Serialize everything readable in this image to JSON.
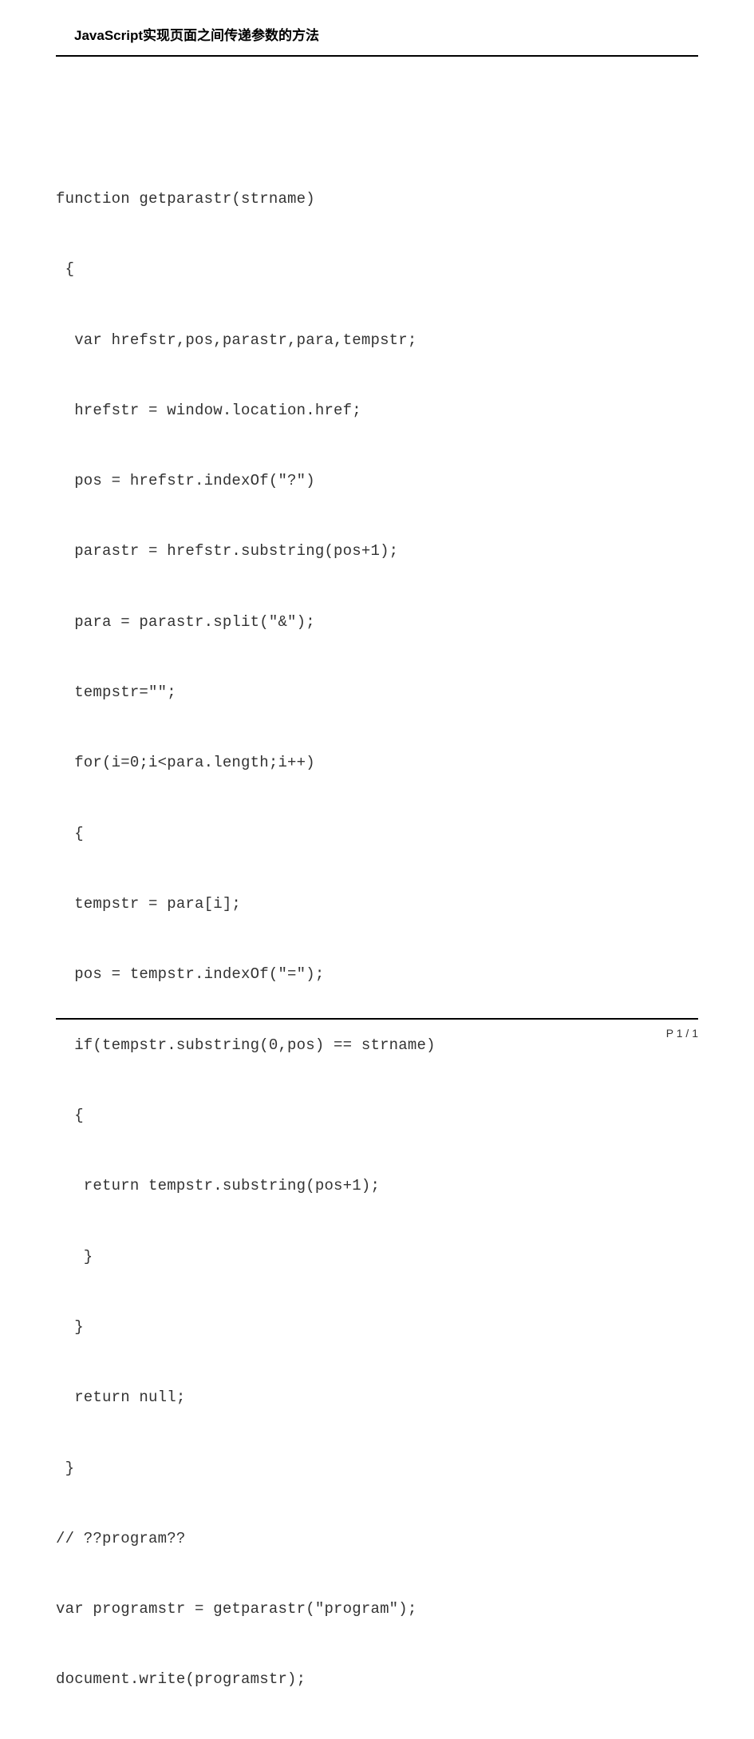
{
  "header": {
    "title": "JavaScript实现页面之间传递参数的方法"
  },
  "code": {
    "lines": [
      "function getparastr(strname)",
      " {",
      "  var hrefstr,pos,parastr,para,tempstr;",
      "  hrefstr = window.location.href;",
      "  pos = hrefstr.indexOf(\"?\")",
      "  parastr = hrefstr.substring(pos+1);",
      "  para = parastr.split(\"&\");",
      "  tempstr=\"\";",
      "  for(i=0;i<para.length;i++)",
      "  {",
      "  tempstr = para[i];",
      "  pos = tempstr.indexOf(\"=\");",
      "  if(tempstr.substring(0,pos) == strname)",
      "  {",
      "   return tempstr.substring(pos+1);",
      "   }",
      "  }",
      "  return null;",
      " }",
      "// ??program??",
      "var programstr = getparastr(\"program\");",
      "document.write(programstr);"
    ]
  },
  "footer": {
    "page_label": "P 1 / 1"
  }
}
